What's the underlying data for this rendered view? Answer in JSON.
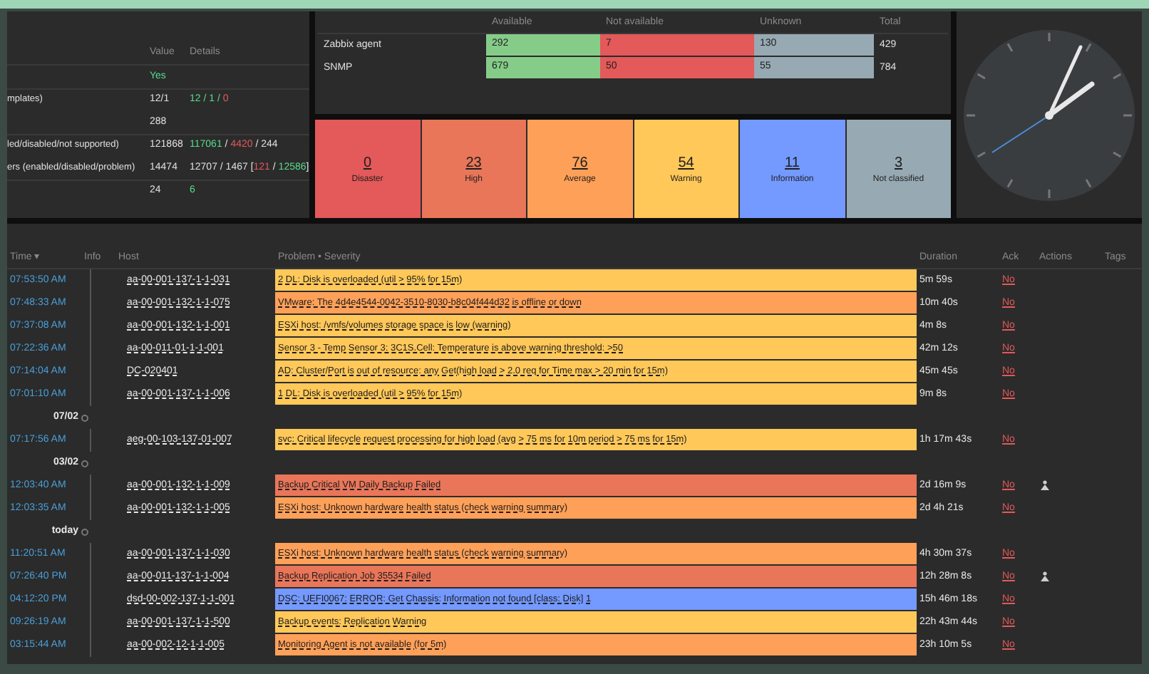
{
  "system_info": {
    "columns": [
      "Value",
      "Details"
    ],
    "rows": [
      {
        "kind": "ok",
        "label": "",
        "value": "Yes",
        "details": []
      },
      {
        "kind": "plain",
        "label": "mplates)",
        "value": "12/1",
        "details": [
          {
            "text": "12 / 1 / ",
            "kind": "ok"
          },
          {
            "text": "0",
            "kind": "bad"
          }
        ]
      },
      {
        "kind": "plain",
        "label": "",
        "value": "288",
        "details": []
      },
      {
        "kind": "plain",
        "label": "led/disabled/not supported)",
        "value": "121868",
        "details": [
          {
            "text": "117061",
            "kind": "ok"
          },
          {
            "text": " / ",
            "kind": "plain"
          },
          {
            "text": "4420",
            "kind": "bad"
          },
          {
            "text": " / 244",
            "kind": "plain"
          }
        ]
      },
      {
        "kind": "plain",
        "label": "ers (enabled/disabled/problem)",
        "value": "14474",
        "details": [
          {
            "text": "12707 / 1467 [",
            "kind": "plain"
          },
          {
            "text": "121",
            "kind": "bad"
          },
          {
            "text": " / ",
            "kind": "plain"
          },
          {
            "text": "12586",
            "kind": "ok"
          },
          {
            "text": "]",
            "kind": "plain"
          }
        ]
      },
      {
        "kind": "plain",
        "label": "",
        "value": "24",
        "details": [
          {
            "text": "6",
            "kind": "ok"
          }
        ]
      }
    ]
  },
  "host_availability": {
    "columns": [
      "Available",
      "Not available",
      "Unknown",
      "Total"
    ],
    "rows": [
      {
        "label": "Zabbix agent",
        "available": "292",
        "not_available": "7",
        "unknown": "130",
        "total": "429"
      },
      {
        "label": "SNMP",
        "available": "679",
        "not_available": "50",
        "unknown": "55",
        "total": "784"
      }
    ]
  },
  "severity_counts": [
    {
      "color": "#e45959",
      "count": "0",
      "label": "Disaster"
    },
    {
      "color": "#e97659",
      "count": "23",
      "label": "High"
    },
    {
      "color": "#ffa059",
      "count": "76",
      "label": "Average"
    },
    {
      "color": "#ffc859",
      "count": "54",
      "label": "Warning"
    },
    {
      "color": "#7499ff",
      "count": "11",
      "label": "Information"
    },
    {
      "color": "#97aab3",
      "count": "3",
      "label": "Not classified"
    }
  ],
  "problems": {
    "columns": [
      "Time ▾",
      "Info",
      "Host",
      "Problem • Severity",
      "Duration",
      "Ack",
      "Actions",
      "Tags"
    ],
    "rows": [
      {
        "kind": "problem",
        "time": "07:53:50 AM",
        "host": "aa-00-001-137-1-1-031",
        "problem": "2 DL: Disk is overloaded (util > 95% for 15m)",
        "color": "#ffc859",
        "duration": "5m 59s",
        "ack": "No",
        "has_action": false
      },
      {
        "kind": "problem",
        "time": "07:48:33 AM",
        "host": "aa-00-001-132-1-1-075",
        "problem": "VMware: The 4d4e4544-0042-3510-8030-b8c04f444d32 is offline or down",
        "color": "#ffa059",
        "duration": "10m 40s",
        "ack": "No",
        "has_action": false
      },
      {
        "kind": "problem",
        "time": "07:37:08 AM",
        "host": "aa-00-001-132-1-1-001",
        "problem": "ESXi host: /vmfs/volumes storage space is low (warning)",
        "color": "#ffc859",
        "duration": "4m 8s",
        "ack": "No",
        "has_action": false
      },
      {
        "kind": "problem",
        "time": "07:22:36 AM",
        "host": "aa-00-011-01-1-1-001",
        "problem": "Sensor 3 - Temp Sensor 3: 3C1S.Cell: Temperature is above warning threshold: >50",
        "color": "#ffc859",
        "duration": "42m 12s",
        "ack": "No",
        "has_action": false
      },
      {
        "kind": "problem",
        "time": "07:14:04 AM",
        "host": "DC-020401",
        "problem": "AD: Cluster/Port is out of resource: any Get(high load > 2.0 req for Time max > 20 min for 15m)",
        "color": "#ffc859",
        "duration": "45m 45s",
        "ack": "No",
        "has_action": false
      },
      {
        "kind": "problem",
        "time": "07:01:10 AM",
        "host": "aa-00-001-137-1-1-006",
        "problem": "1 DL: Disk is overloaded (util > 95% for 15m)",
        "color": "#ffc859",
        "duration": "9m 8s",
        "ack": "No",
        "has_action": false
      },
      {
        "kind": "date",
        "label": "07/02"
      },
      {
        "kind": "problem",
        "time": "07:17:56 AM",
        "host": "aeg-00-103-137-01-007",
        "problem": "svc: Critical lifecycle request processing for high load (avg > 75 ms for 10m period > 75 ms for 15m)",
        "color": "#ffc859",
        "duration": "1h 17m 43s",
        "ack": "No",
        "has_action": false
      },
      {
        "kind": "date",
        "label": "03/02"
      },
      {
        "kind": "problem",
        "time": "12:03:40 AM",
        "host": "aa-00-001-132-1-1-009",
        "problem": "Backup Critical VM Daily Backup Failed",
        "color": "#e97659",
        "duration": "2d 16m 9s",
        "ack": "No",
        "has_action": true
      },
      {
        "kind": "problem",
        "time": "12:03:35 AM",
        "host": "aa-00-001-132-1-1-005",
        "problem": "ESXi host: Unknown hardware health status (check warning summary)",
        "color": "#ffa059",
        "duration": "2d 4h 21s",
        "ack": "No",
        "has_action": false
      },
      {
        "kind": "date",
        "label": "today"
      },
      {
        "kind": "problem",
        "time": "11:20:51 AM",
        "host": "aa-00-001-137-1-1-030",
        "problem": "ESXi host: Unknown hardware health status (check warning summary)",
        "color": "#ffa059",
        "duration": "4h 30m 37s",
        "ack": "No",
        "has_action": false
      },
      {
        "kind": "problem",
        "time": "07:26:40 PM",
        "host": "aa-00-011-137-1-1-004",
        "problem": "Backup Replication Job 35534 Failed",
        "color": "#e97659",
        "duration": "12h 28m 8s",
        "ack": "No",
        "has_action": true
      },
      {
        "kind": "problem",
        "time": "04:12:20 PM",
        "host": "dsd-00-002-137-1-1-001",
        "problem": "DSC: UEFI0067: ERROR: Get Chassis: Information not found [class: Disk] 1",
        "color": "#7499ff",
        "duration": "15h 46m 18s",
        "ack": "No",
        "has_action": false
      },
      {
        "kind": "problem",
        "time": "09:26:19 AM",
        "host": "aa-00-001-137-1-1-500",
        "problem": "Backup events: Replication Warning",
        "color": "#ffc859",
        "duration": "22h 43m 44s",
        "ack": "No",
        "has_action": false
      },
      {
        "kind": "problem",
        "time": "03:15:44 AM",
        "host": "aa-00-002-12-1-1-005",
        "problem": "Monitoring Agent is not available (for 5m)",
        "color": "#ffa059",
        "duration": "23h 10m 5s",
        "ack": "No",
        "has_action": false
      }
    ]
  }
}
